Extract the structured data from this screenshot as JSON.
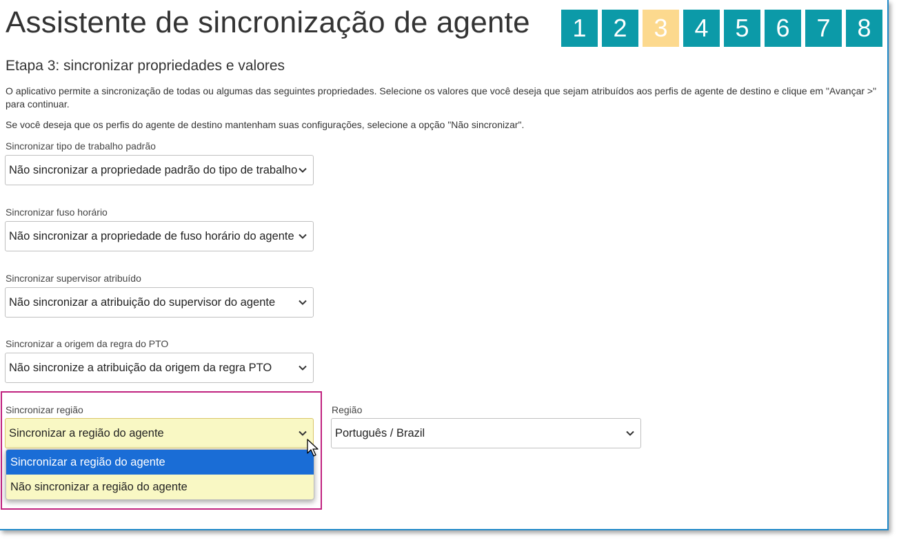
{
  "title": "Assistente de sincronização de agente",
  "steps": [
    "1",
    "2",
    "3",
    "4",
    "5",
    "6",
    "7",
    "8"
  ],
  "active_step": "3",
  "colors": {
    "step": "#0c9aa8",
    "active_step": "#fcd98e",
    "highlight": "#c0207e",
    "dropdown_selected": "#1a6dd6",
    "select_yellow": "#f9f8c4"
  },
  "subtitle": "Etapa 3: sincronizar propriedades e valores",
  "intro": "O aplicativo permite a sincronização de todas ou algumas das seguintes propriedades. Selecione os valores que você deseja que sejam atribuídos aos perfis de agente de destino e clique em \"Avançar >\" para continuar.",
  "note": "Se você deseja que os perfis do agente de destino mantenham suas configurações, selecione a opção \"Não sincronizar\".",
  "fields": {
    "work_type": {
      "label": "Sincronizar tipo de trabalho padrão",
      "value": "Não sincronizar a propriedade padrão do tipo de trabalho"
    },
    "time_zone": {
      "label": "Sincronizar fuso horário",
      "value": "Não sincronizar a propriedade de fuso horário do agente"
    },
    "supervisor": {
      "label": "Sincronizar supervisor atribuído",
      "value": "Não sincronizar a atribuição do supervisor do agente"
    },
    "pto": {
      "label": "Sincronizar a origem da regra do PTO",
      "value": "Não sincronize a atribuição da origem da regra PTO"
    },
    "region": {
      "label": "Sincronizar região",
      "value": "Sincronizar a região do agente",
      "options": [
        "Sincronizar a região do agente",
        "Não sincronizar a região do agente"
      ]
    },
    "region_value": {
      "label": "Região",
      "value": "Português / Brazil"
    }
  },
  "icons": {
    "chevron": "chevron-down-icon",
    "cursor": "mouse-pointer-icon"
  }
}
